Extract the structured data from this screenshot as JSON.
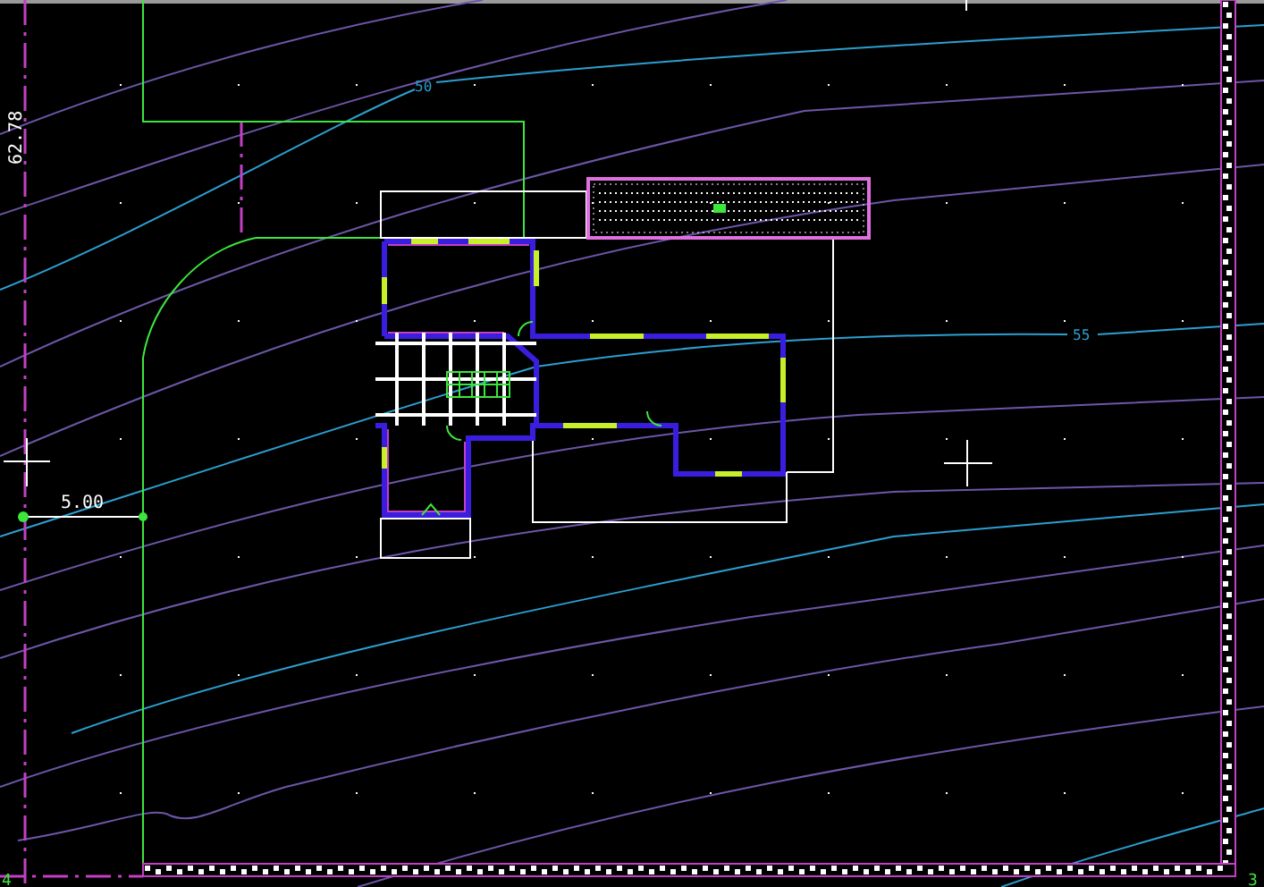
{
  "vertical_dimension": {
    "text": "62.78"
  },
  "horizontal_dimension": {
    "text": "5.00"
  },
  "contour_labels": [
    "50",
    "55"
  ],
  "corner_labels": [
    "4",
    "3"
  ]
}
